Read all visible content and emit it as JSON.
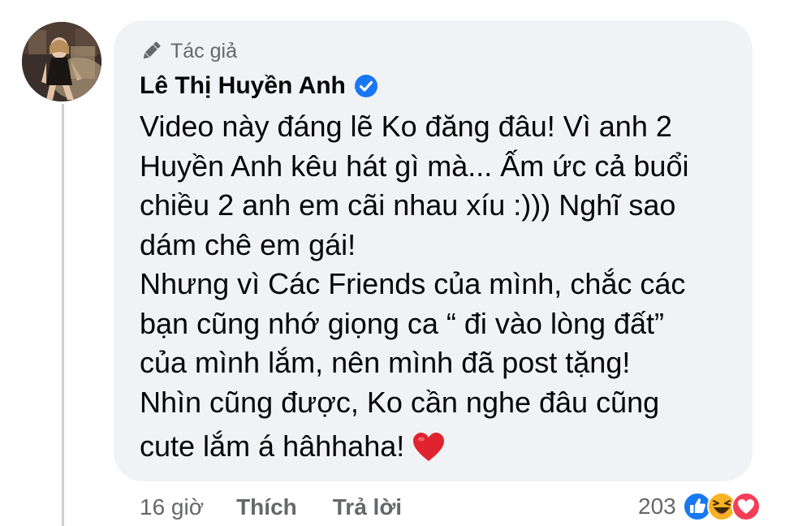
{
  "comment": {
    "badge": "Tác giả",
    "author": "Lê Thị Huyền Anh",
    "verified": true,
    "text_lines": [
      "Video này đáng lẽ Ko đăng đâu! Vì anh 2",
      "Huyền Anh kêu hát gì mà... Ấm ức cả buổi",
      "chiều 2 anh em cãi nhau xíu :))) Nghĩ sao",
      "dám chê em gái!",
      "Nhưng vì Các Friends của mình, chắc các",
      "bạn cũng nhớ giọng ca “ đi vào lòng đất”",
      "của mình lắm, nên mình đã post tặng!",
      "Nhìn cũng được, Ko cần nghe đâu cũng",
      "cute lắm á hâhhaha!"
    ],
    "emoji": "heart-emoji"
  },
  "actions": {
    "time": "16 giờ",
    "like": "Thích",
    "reply": "Trả lời"
  },
  "reactions": {
    "count": "203",
    "icons": [
      "like-icon",
      "haha-icon",
      "love-icon"
    ]
  },
  "colors": {
    "bubble": "#f0f2f5",
    "text": "#050505",
    "secondary": "#65676b",
    "verified": "#1877f2",
    "like": "#1877f2",
    "haha": "#f7b125",
    "love": "#f33e58"
  }
}
